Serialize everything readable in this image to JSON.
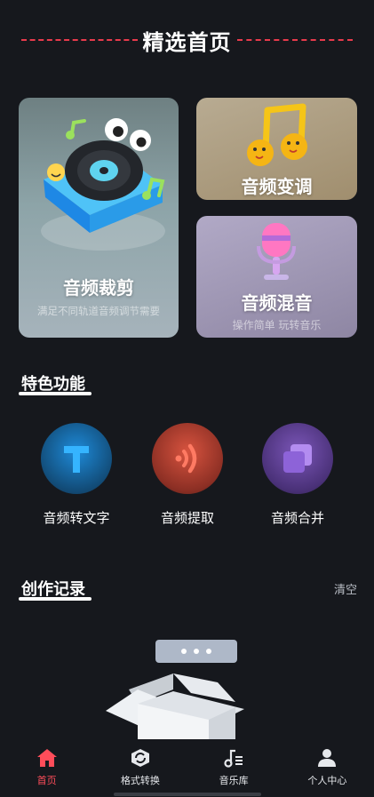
{
  "header": {
    "title": "精选首页",
    "accent_color": "#e83a4c"
  },
  "cards": {
    "clip": {
      "title": "音频裁剪",
      "subtitle": "满足不同轨道音频调节需要",
      "icon": "turntable-icon"
    },
    "pitch": {
      "title": "音频变调",
      "icon": "music-note-icon"
    },
    "mix": {
      "title": "音频混音",
      "subtitle": "操作简单 玩转音乐",
      "icon": "microphone-icon"
    }
  },
  "features": {
    "title": "特色功能",
    "items": [
      {
        "label": "音频转文字",
        "icon": "text-t-icon",
        "color": "#1e8ad8"
      },
      {
        "label": "音频提取",
        "icon": "sound-wave-icon",
        "color": "#e2533f"
      },
      {
        "label": "音频合并",
        "icon": "merge-squares-icon",
        "color": "#8a60c8"
      }
    ]
  },
  "records": {
    "title": "创作记录",
    "clear_label": "清空",
    "empty_icon": "empty-box-icon"
  },
  "tabbar": {
    "items": [
      {
        "label": "首页",
        "icon": "home-icon",
        "active": true
      },
      {
        "label": "格式转换",
        "icon": "convert-icon",
        "active": false
      },
      {
        "label": "音乐库",
        "icon": "music-library-icon",
        "active": false
      },
      {
        "label": "个人中心",
        "icon": "person-icon",
        "active": false
      }
    ],
    "active_color": "#ff4d5a"
  }
}
